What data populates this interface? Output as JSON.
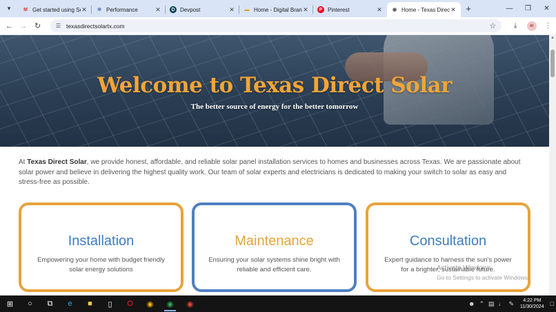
{
  "browser": {
    "tabs": [
      {
        "title": "Get started using Sea",
        "icon": "gmail-icon",
        "icon_color": "#d93025"
      },
      {
        "title": "Performance",
        "icon": "performance-icon",
        "icon_color": "#4a7cc7"
      },
      {
        "title": "Devpost",
        "icon": "devpost-icon",
        "icon_color": "#003e54"
      },
      {
        "title": "Home - Digital Brand",
        "icon": "brand-icon",
        "icon_color": "#e0a020"
      },
      {
        "title": "Pinterest",
        "icon": "pinterest-icon",
        "icon_color": "#e60023"
      },
      {
        "title": "Home - Texas Direct",
        "icon": "globe-icon",
        "icon_color": "#555555",
        "active": true
      }
    ],
    "url": "texasdirectsolartx.com",
    "profile_initials": "AI"
  },
  "hero": {
    "title": "Welcome to Texas Direct Solar",
    "subtitle": "The better source of energy for the better tomorrow"
  },
  "intro": {
    "prefix": "At ",
    "brand": "Texas Direct Solar",
    "body": ", we provide honest, affordable, and reliable solar panel installation services to homes and businesses across Texas. We are passionate about solar power and believe in delivering the highest quality work. Our team of solar experts and electricians is dedicated to making your switch to solar as easy and stress-free as possible."
  },
  "cards": [
    {
      "title": "Installation",
      "text": "Empowering your home with budget friendly solar energy solutions",
      "title_color": "#3f7cbf",
      "border_color": "#e8a33a"
    },
    {
      "title": "Maintenance",
      "text": "Ensuring your solar systems shine bright with reliable and efficient care.",
      "title_color": "#e8a33a",
      "border_color": "#4f7fc0"
    },
    {
      "title": "Consultation",
      "text": "Expert guidance to harness the sun's power for a brighter, sustainable future.",
      "title_color": "#3f7cbf",
      "border_color": "#e8a33a"
    }
  ],
  "watermark": {
    "line1": "Activate Windows",
    "line2": "Go to Settings to activate Windows."
  },
  "taskbar": {
    "time": "4:22 PM",
    "date": "11/30/2024"
  }
}
